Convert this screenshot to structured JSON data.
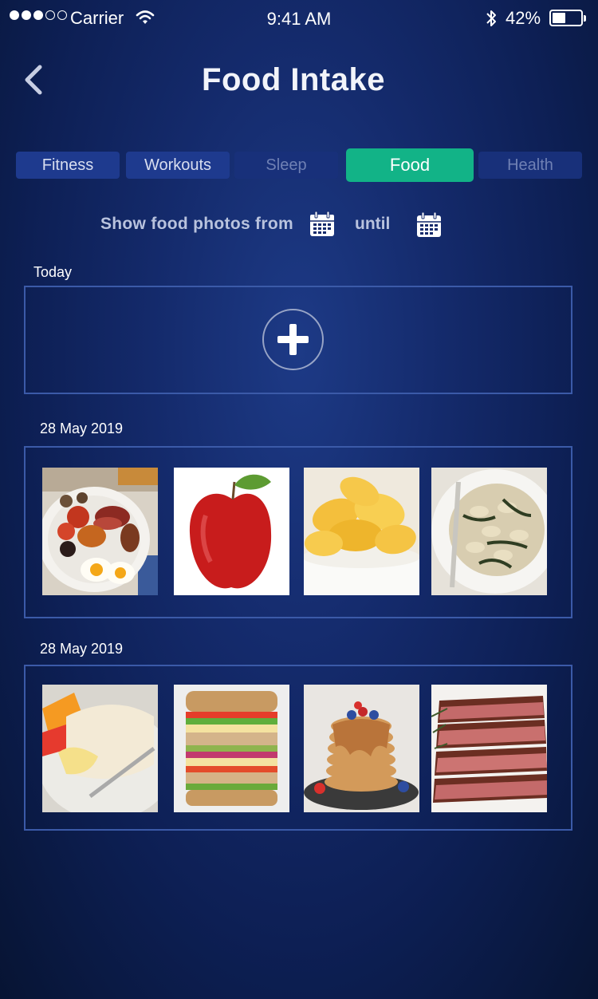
{
  "status_bar": {
    "carrier": "Carrier",
    "time": "9:41 AM",
    "battery": "42%",
    "battery_level": 0.42,
    "signal_bars_filled": 3,
    "signal_bars_total": 5
  },
  "header": {
    "title": "Food Intake",
    "back_icon": "chevron-left-icon"
  },
  "tabs": [
    {
      "label": "Fitness",
      "state": "normal"
    },
    {
      "label": "Workouts",
      "state": "normal"
    },
    {
      "label": "Sleep",
      "state": "dim"
    },
    {
      "label": "Food",
      "state": "active"
    },
    {
      "label": "Health",
      "state": "dim"
    }
  ],
  "filter": {
    "label": "Show food photos from",
    "until": "until",
    "icon": "calendar-icon"
  },
  "sections": [
    {
      "label": "Today",
      "add_icon": "plus-icon"
    },
    {
      "label": "28 May 2019",
      "photos": [
        "full-breakfast",
        "red-apple",
        "potato-chips",
        "bowtie-pasta"
      ]
    },
    {
      "label": "28 May 2019",
      "photos": [
        "breakfast-burrito",
        "veggie-sandwich",
        "pancakes",
        "sliced-steak"
      ]
    }
  ],
  "colors": {
    "accent": "#12b387",
    "tab_bg": "#1e3a8e",
    "panel_border": "#3b5aa8",
    "bg_dark": "#0d1f54"
  }
}
